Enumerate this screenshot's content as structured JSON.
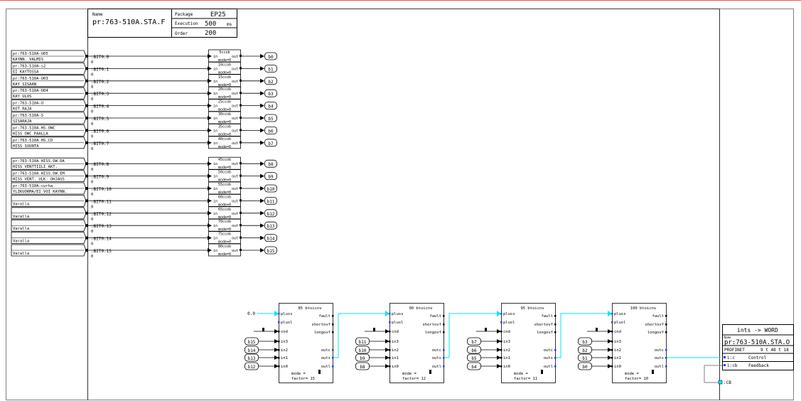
{
  "header": {
    "name_label": "Name",
    "name_value": "pr:763-510A.STA.F",
    "package_label": "Package",
    "package_value": "EP25",
    "execution_label": "Execution",
    "execution_value": "500",
    "execution_unit": "ms",
    "order_label": "Order",
    "order_value": "200"
  },
  "inputs": [
    {
      "line1": "pr:763-510A-U05",
      "line2": "KAYNN. VALMIS",
      "bit": ":BIT0.0",
      "val": "0",
      "block": "5ccob",
      "out": "b0"
    },
    {
      "line1": "pr:763-510A:s2",
      "line2": "EI KAYTOSSA",
      "bit": ":BIT0.1",
      "val": "0",
      "block": "10ccob",
      "out": "b1"
    },
    {
      "line1": "pr:763-510A-U03",
      "line2": "KAY SISAAN",
      "bit": ":BIT0.2",
      "val": "0",
      "block": "15ccob",
      "out": "b2"
    },
    {
      "line1": "pr:763-510A-U04",
      "line2": "KAY ULOS",
      "bit": ":BIT0.3",
      "val": "0",
      "block": "20ccob",
      "out": "b3"
    },
    {
      "line1": "pr:763-510A-U",
      "line2": "KOT RAJA",
      "bit": ":BIT0.4",
      "val": "0",
      "block": "25ccob",
      "out": "b4"
    },
    {
      "line1": "pr:763-510A-S",
      "line2": "SISARAJA",
      "bit": ":BIT0.5",
      "val": "0",
      "block": "30ccob",
      "out": "b5"
    },
    {
      "line1": "pr:763-510A.HS.OWC",
      "line2": "HISS OWC PAALLA",
      "bit": ":BIT0.6",
      "val": "0",
      "block": "35ccob",
      "out": "b6"
    },
    {
      "line1": "pr:763-510A.HS.CD",
      "line2": "HISS SUUNTA",
      "bit": ":BIT0.7",
      "val": "0",
      "block": "40ccob",
      "out": "b7"
    },
    {
      "line1": "pr:763-510A.HISS.OW.DA",
      "line2": "HISS VENTTIILI AKT.",
      "bit": ":BIT0.8",
      "val": "0",
      "block": "45ccob",
      "out": "b8"
    },
    {
      "line1": "pr:763-510A.HISS.OW.EM",
      "line2": "HISS VENT. ULK. OHJAUS",
      "bit": ":BIT0.9",
      "val": "0",
      "block": "50ccob",
      "out": "b9"
    },
    {
      "line1": "pr:763-510A:curha",
      "line2": "YLIKUORMA/EI VOI KAYNN.",
      "bit": ":BIT0.10",
      "val": "0",
      "block": "55ccob",
      "out": "b10"
    },
    {
      "line1": "",
      "line2": "Varalla",
      "bit": ":BIT0.11",
      "val": "0",
      "block": "60ccob",
      "out": "b11"
    },
    {
      "line1": "",
      "line2": "Varalla",
      "bit": ":BIT0.12",
      "val": "0",
      "block": "65ccob",
      "out": "b12"
    },
    {
      "line1": "",
      "line2": "Varalla",
      "bit": ":BIT0.13",
      "val": "0",
      "block": "70ccob",
      "out": "b13"
    },
    {
      "line1": "",
      "line2": "Varalla",
      "bit": ":BIT0.14",
      "val": "0",
      "block": "75ccob",
      "out": "b14"
    },
    {
      "line1": "",
      "line2": "Varalla",
      "bit": ":BIT0.15",
      "val": "0",
      "block": "80ccob",
      "out": "b15"
    }
  ],
  "small_block": {
    "pin_in": "in",
    "pin_out": "out",
    "mode": "mode=0"
  },
  "converters": [
    {
      "title": "85 btoicnv",
      "mode_text": "mode  =",
      "factor_text": "factor=  15",
      "ins": [
        "b15",
        "b14",
        "b13",
        "b12"
      ],
      "const_in": "0.0"
    },
    {
      "title": "90 btoicnv",
      "mode_text": "mode  =",
      "factor_text": "factor=  12",
      "ins": [
        "b11",
        "b10",
        "b9",
        "b8"
      ],
      "const_in": ""
    },
    {
      "title": "95 btoicnv",
      "mode_text": "mode  =",
      "factor_text": "factor=  11",
      "ins": [
        "b7",
        "b6",
        "b5",
        "b4"
      ],
      "const_in": ""
    },
    {
      "title": "100 btoicnv",
      "mode_text": "mode  =",
      "factor_text": "factor=  10",
      "ins": [
        "b3",
        "b2",
        "b1",
        "b0"
      ],
      "const_in": ""
    }
  ],
  "converter_pins_left": [
    "pluss",
    "plusl",
    "cnd",
    "in3",
    "in2",
    "in1",
    "in0"
  ],
  "converter_pins_right": [
    "fault",
    "shortovf",
    "longovf",
    "outc",
    "outs",
    "outl"
  ],
  "word_block": {
    "title": "ints -> WORD",
    "name_label": "Name",
    "name_value": "pr:763-510A.STA.O",
    "protocol": "PROFINET",
    "address": "9 t 48 t 18",
    "pin1": "i:c",
    "pin1_label": "Control",
    "pin2": "i:cb",
    "pin2_label": "Feedback",
    "loop_label": ":CB"
  },
  "colors": {
    "wire": "#000000",
    "accent": "#00e5ff",
    "pin": "#1a3cff",
    "frame_top": "#ff0000"
  }
}
